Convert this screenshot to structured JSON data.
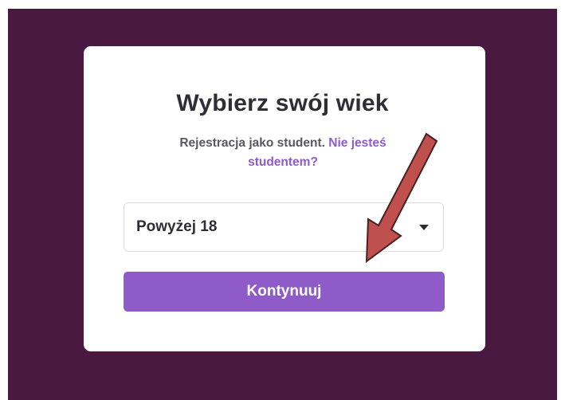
{
  "dialog": {
    "title": "Wybierz swój wiek",
    "subtitle_text": "Rejestracja jako student.",
    "subtitle_link": "Nie jesteś studentem?"
  },
  "age_select": {
    "selected_value": "Powyżej 18"
  },
  "continue_button": {
    "label": "Kontynuuj"
  },
  "colors": {
    "background": "#4a1942",
    "accent": "#8e5bc9",
    "annotation_arrow": "#c0504d"
  },
  "icons": {
    "select_caret": "caret-down-icon",
    "annotation": "red-arrow-annotation"
  }
}
